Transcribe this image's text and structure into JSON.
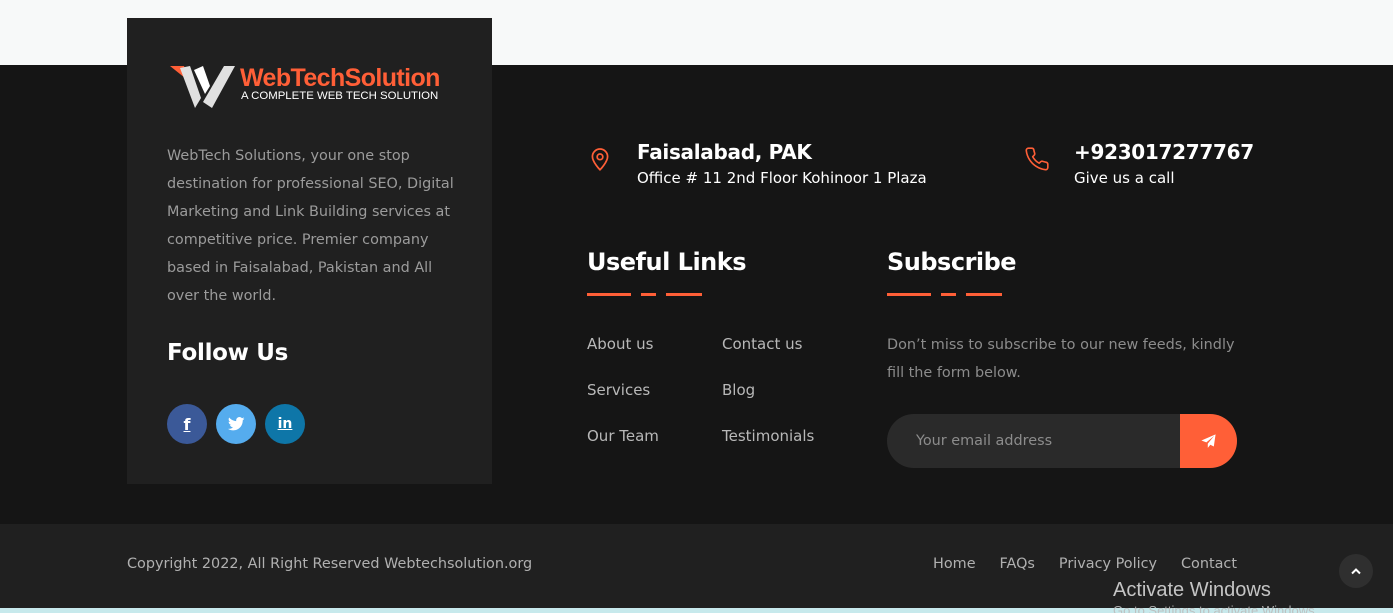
{
  "brand": {
    "name": "WebTechSolution",
    "tagline": "A COMPLETE WEB TECH SOLUTION",
    "accent_color": "#ff5f37"
  },
  "about": {
    "text": "WebTech Solutions, your one stop destination for professional SEO, Digital Marketing and Link Building services at competitive price. Premier company based in Faisalabad, Pakistan and All over the world."
  },
  "follow": {
    "title": "Follow Us",
    "networks": [
      {
        "name": "facebook",
        "icon": "facebook-icon",
        "glyph": "f",
        "color": "#3b5998"
      },
      {
        "name": "twitter",
        "icon": "twitter-icon",
        "color": "#55acee"
      },
      {
        "name": "linkedin",
        "icon": "linkedin-icon",
        "glyph": "in",
        "color": "#0e76a8"
      }
    ]
  },
  "contact": {
    "address": {
      "title": "Faisalabad, PAK",
      "subtitle": "Office # 11 2nd Floor Kohinoor 1 Plaza",
      "icon": "map-pin-icon"
    },
    "phone": {
      "title": "+923017277767",
      "subtitle": "Give us a call",
      "icon": "phone-icon"
    }
  },
  "useful_links": {
    "title": "Useful Links",
    "column1": [
      "About us",
      "Services",
      "Our Team"
    ],
    "column2": [
      "Contact us",
      "Blog",
      "Testimonials"
    ]
  },
  "subscribe": {
    "title": "Subscribe",
    "text": "Don’t miss to subscribe to our new feeds, kindly fill the form below.",
    "placeholder": "Your email address",
    "button_icon": "paper-plane-icon"
  },
  "bottom": {
    "copyright": "Copyright 2022, All Right Reserved Webtechsolution.org",
    "nav": [
      "Home",
      "FAQs",
      "Privacy Policy",
      "Contact"
    ],
    "scroll_top_icon": "chevron-up-icon"
  },
  "watermark": {
    "title": "Activate Windows",
    "subtitle": "Go to Settings to activate Windows."
  }
}
